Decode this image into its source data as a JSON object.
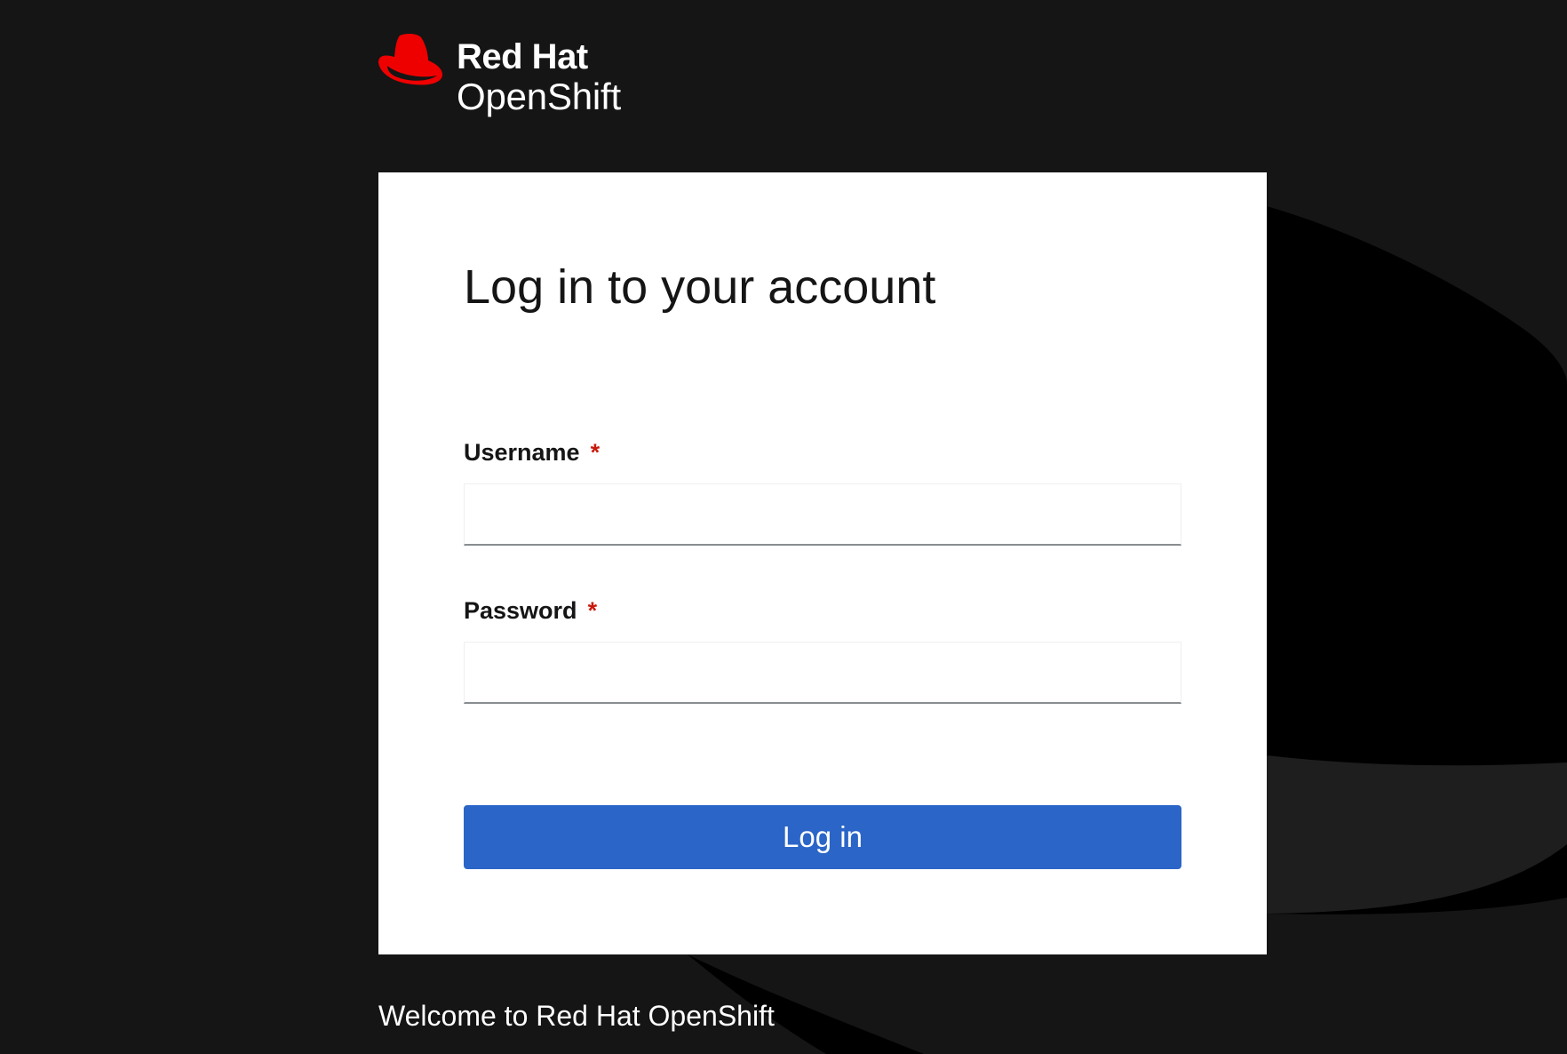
{
  "brand": {
    "line1": "Red Hat",
    "line2": "OpenShift",
    "logo_icon": "red-hat-fedora-icon",
    "accent_color": "#ee0000"
  },
  "login": {
    "title": "Log in to your account",
    "username_label": "Username",
    "password_label": "Password",
    "required_marker": "*",
    "username_value": "",
    "password_value": "",
    "submit_label": "Log in"
  },
  "footer": {
    "welcome": "Welcome to Red Hat OpenShift"
  },
  "colors": {
    "background": "#151515",
    "card": "#ffffff",
    "primary_button": "#2b65c8",
    "required": "#c9190b"
  }
}
